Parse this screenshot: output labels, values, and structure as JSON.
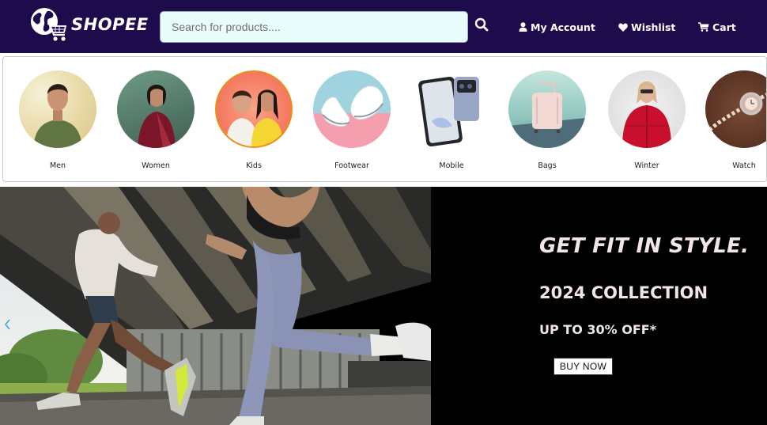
{
  "brand": {
    "name": "SHOPEE",
    "logo_icon": "globe-cart-icon"
  },
  "search": {
    "placeholder": "Search for products....",
    "icon": "search-icon"
  },
  "nav": {
    "account": {
      "label": "My Account",
      "icon": "user-icon"
    },
    "wishlist": {
      "label": "Wishlist",
      "icon": "heart-icon"
    },
    "cart": {
      "label": "Cart",
      "icon": "cart-icon"
    }
  },
  "categories": [
    {
      "label": "Men"
    },
    {
      "label": "Women"
    },
    {
      "label": "Kids"
    },
    {
      "label": "Footwear"
    },
    {
      "label": "Mobile"
    },
    {
      "label": "Bags"
    },
    {
      "label": "Winter"
    },
    {
      "label": "Watch"
    }
  ],
  "banner": {
    "headline": "GET FIT IN STYLE.",
    "collection": "2024 COLLECTION",
    "offer": "UP TO 30% OFF*",
    "button": "BUY NOW",
    "prev_icon": "chevron-left-icon"
  },
  "colors": {
    "header_bg": "#1e0b4b",
    "search_bg": "#e9fdfd",
    "banner_bg": "#000000",
    "promo_text": "#f1e5ec"
  }
}
